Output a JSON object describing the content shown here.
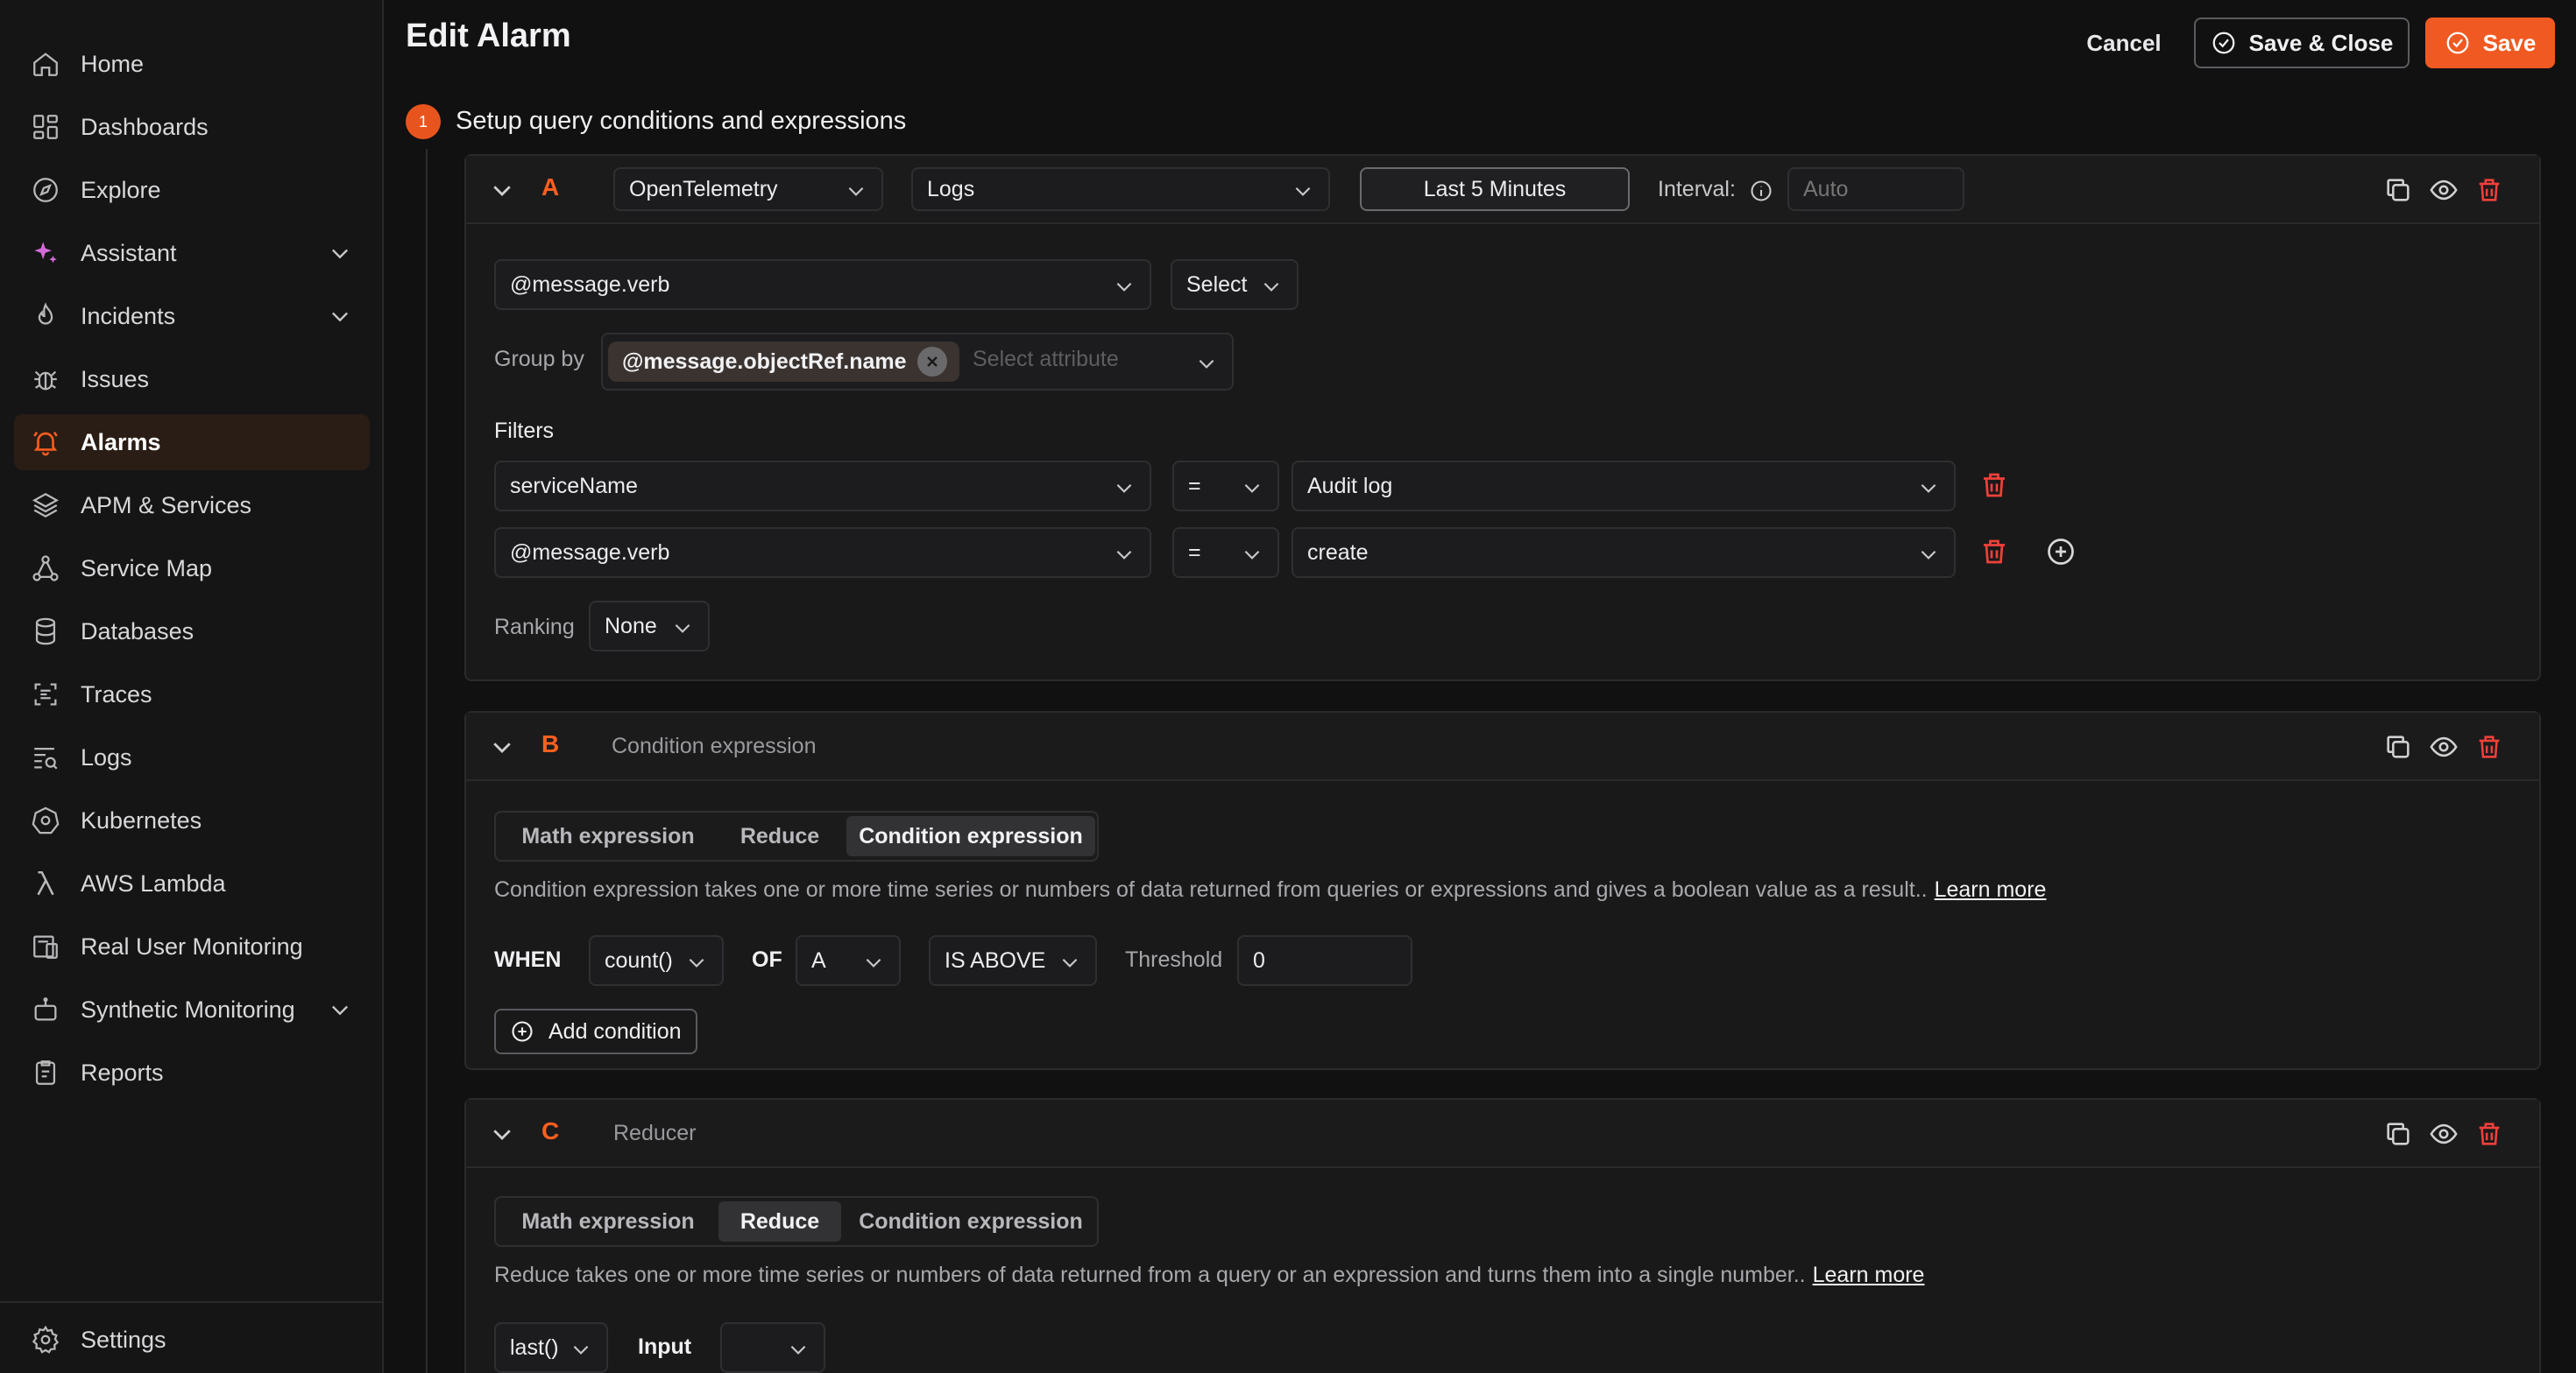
{
  "sidebar": {
    "items": [
      {
        "label": "Home",
        "icon": "home-icon"
      },
      {
        "label": "Dashboards",
        "icon": "dashboards-icon"
      },
      {
        "label": "Explore",
        "icon": "compass-icon"
      },
      {
        "label": "Assistant",
        "icon": "sparkle-icon"
      },
      {
        "label": "Incidents",
        "icon": "flame-icon"
      },
      {
        "label": "Issues",
        "icon": "bug-icon"
      },
      {
        "label": "Alarms",
        "icon": "bell-icon"
      },
      {
        "label": "APM & Services",
        "icon": "layers-icon"
      },
      {
        "label": "Service Map",
        "icon": "service-map-icon"
      },
      {
        "label": "Databases",
        "icon": "database-icon"
      },
      {
        "label": "Traces",
        "icon": "traces-icon"
      },
      {
        "label": "Logs",
        "icon": "logs-icon"
      },
      {
        "label": "Kubernetes",
        "icon": "kubernetes-icon"
      },
      {
        "label": "AWS Lambda",
        "icon": "lambda-icon"
      },
      {
        "label": "Real User Monitoring",
        "icon": "rum-icon"
      },
      {
        "label": "Synthetic Monitoring",
        "icon": "robot-icon"
      },
      {
        "label": "Reports",
        "icon": "reports-icon"
      }
    ],
    "settings_label": "Settings",
    "accent": "#ff5f1f"
  },
  "header": {
    "title": "Edit Alarm",
    "cancel_label": "Cancel",
    "save_close_label": "Save & Close",
    "save_label": "Save"
  },
  "step": {
    "number": "1",
    "title": "Setup query conditions and expressions"
  },
  "query_a": {
    "letter": "A",
    "datasource": "OpenTelemetry",
    "signal": "Logs",
    "time_range": "Last 5 Minutes",
    "interval_label": "Interval:",
    "interval_placeholder": "Auto",
    "field": "@message.verb",
    "aggregation": "Select",
    "group_by_label": "Group by",
    "group_by_chip": "@message.objectRef.name",
    "group_by_placeholder": "Select attribute",
    "filters_label": "Filters",
    "filters": [
      {
        "key": "serviceName",
        "op": "=",
        "value": "Audit log"
      },
      {
        "key": "@message.verb",
        "op": "=",
        "value": "create"
      }
    ],
    "ranking_label": "Ranking",
    "ranking_value": "None"
  },
  "query_b": {
    "letter": "B",
    "title": "Condition expression",
    "tabs": [
      "Math expression",
      "Reduce",
      "Condition expression"
    ],
    "description": "Condition expression takes one or more time series or numbers of data returned from queries or expressions and gives a boolean value as a result..",
    "learn_more": "Learn more",
    "when_label": "WHEN",
    "func": "count()",
    "of_label": "OF",
    "of_value": "A",
    "comparator": "IS ABOVE",
    "threshold_label": "Threshold",
    "threshold_value": "0",
    "add_condition_label": "Add condition"
  },
  "query_c": {
    "letter": "C",
    "title": "Reducer",
    "tabs": [
      "Math expression",
      "Reduce",
      "Condition expression"
    ],
    "description": "Reduce takes one or more time series or numbers of data returned from a query or an expression and turns them into a single number..",
    "learn_more": "Learn more",
    "func": "last()",
    "input_label": "Input"
  }
}
